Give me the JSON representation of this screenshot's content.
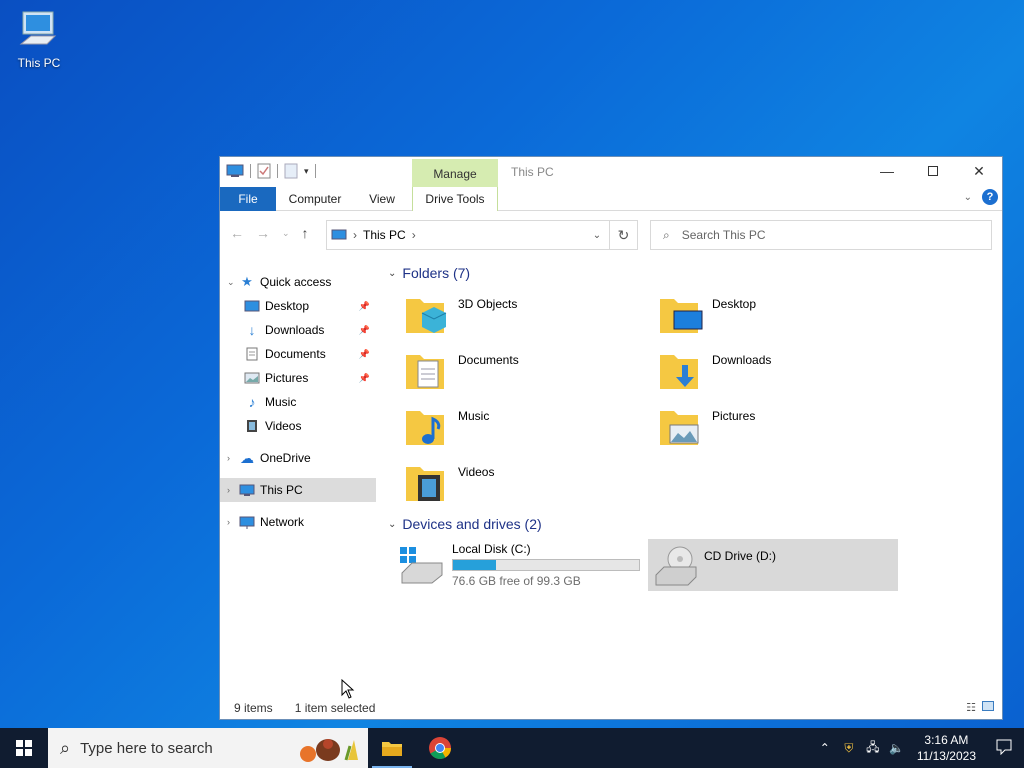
{
  "desktop": {
    "this_pc_label": "This PC"
  },
  "window": {
    "title": "This PC",
    "manage_tab": "Manage",
    "ribbon_tabs": [
      "File",
      "Computer",
      "View",
      "Drive Tools"
    ],
    "address": {
      "crumb": "This PC"
    },
    "search_placeholder": "Search This PC"
  },
  "nav": {
    "quick_access": "Quick access",
    "quick_items": [
      "Desktop",
      "Downloads",
      "Documents",
      "Pictures",
      "Music",
      "Videos"
    ],
    "onedrive": "OneDrive",
    "this_pc": "This PC",
    "network": "Network"
  },
  "content": {
    "folders_header": "Folders (7)",
    "folders": [
      "3D Objects",
      "Desktop",
      "Documents",
      "Downloads",
      "Music",
      "Pictures",
      "Videos"
    ],
    "drives_header": "Devices and drives (2)",
    "drives": [
      {
        "name": "Local Disk (C:)",
        "free_text": "76.6 GB free of 99.3 GB",
        "used_fraction": 0.229
      },
      {
        "name": "CD Drive (D:)"
      }
    ]
  },
  "status": {
    "items": "9 items",
    "selected": "1 item selected"
  },
  "taskbar": {
    "search_placeholder": "Type here to search",
    "time": "3:16 AM",
    "date": "11/13/2023"
  },
  "colors": {
    "accent": "#1a69bf",
    "manage_tab": "#d6ecb1",
    "drive_fill": "#26a0da",
    "taskbar": "#101c30"
  }
}
